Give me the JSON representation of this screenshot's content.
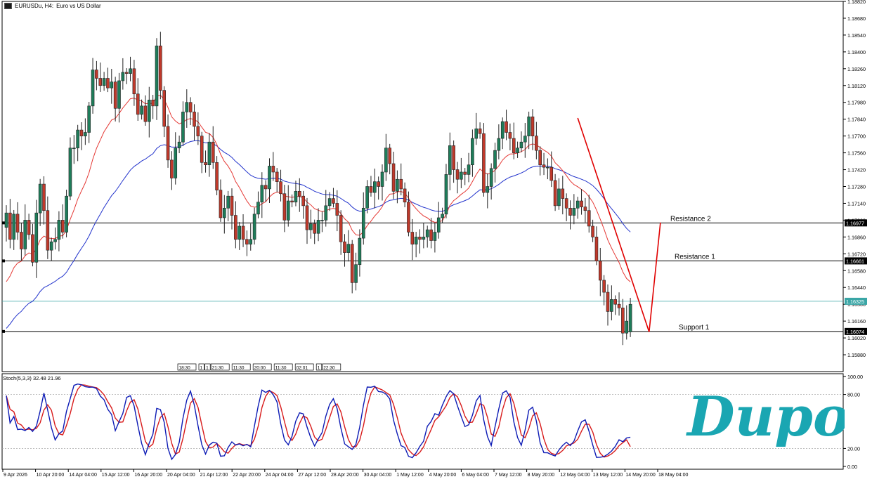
{
  "header": {
    "symbol": "EURUSDu, H4:",
    "description": "Euro vs US Dollar"
  },
  "colors": {
    "bull": "#1e7d5a",
    "bear": "#c0392b",
    "ma_fast": "#e53935",
    "ma_slow": "#2233cc",
    "stoch_k": "#0d1bb5",
    "stoch_d": "#d81b1b",
    "pattern": "#e00000",
    "bid_line": "#3aa6a6",
    "logo": "#1aa6b2"
  },
  "chart_data": [
    {
      "type": "candlestick",
      "symbol": "EURUSDu",
      "timeframe": "H4",
      "ylim": [
        1.1574,
        1.1882
      ],
      "y_ticks": [
        "1.18820",
        "1.18680",
        "1.18540",
        "1.18400",
        "1.18260",
        "1.18120",
        "1.17980",
        "1.17840",
        "1.17700",
        "1.17560",
        "1.17420",
        "1.17280",
        "1.17140",
        "1.17000",
        "1.16860",
        "1.16720",
        "1.16580",
        "1.16440",
        "1.16300",
        "1.16160",
        "1.16020",
        "1.15880"
      ],
      "x_ticks": [
        "9 Apr 2026",
        "10 Apr 20:00",
        "14 Apr 04:00",
        "15 Apr 12:00",
        "16 Apr 20:00",
        "20 Apr 04:00",
        "21 Apr 12:00",
        "22 Apr 20:00",
        "24 Apr 04:00",
        "27 Apr 12:00",
        "28 Apr 20:00",
        "30 Apr 04:00",
        "1 May 12:00",
        "4 May 20:00",
        "6 May 04:00",
        "7 May 12:00",
        "8 May 20:00",
        "12 May 04:00",
        "13 May 12:00",
        "14 May 20:00",
        "18 May 04:00"
      ],
      "closes": [
        1.1706,
        1.1684,
        1.1705,
        1.169,
        1.1676,
        1.17,
        1.1688,
        1.1665,
        1.1706,
        1.173,
        1.1708,
        1.1675,
        1.1682,
        1.1684,
        1.17,
        1.169,
        1.172,
        1.176,
        1.176,
        1.1775,
        1.177,
        1.1773,
        1.1795,
        1.1825,
        1.1818,
        1.1812,
        1.1818,
        1.181,
        1.1815,
        1.1793,
        1.1816,
        1.1823,
        1.1822,
        1.1826,
        1.1805,
        1.1788,
        1.1795,
        1.1782,
        1.18,
        1.1795,
        1.1845,
        1.1808,
        1.1778,
        1.175,
        1.1735,
        1.176,
        1.1765,
        1.179,
        1.1798,
        1.179,
        1.1778,
        1.177,
        1.1748,
        1.1746,
        1.1765,
        1.1748,
        1.1725,
        1.1702,
        1.171,
        1.172,
        1.1704,
        1.1684,
        1.1695,
        1.1684,
        1.168,
        1.1684,
        1.1705,
        1.1715,
        1.1729,
        1.1726,
        1.1745,
        1.174,
        1.1732,
        1.1722,
        1.17,
        1.1716,
        1.1715,
        1.1724,
        1.172,
        1.1712,
        1.1692,
        1.1697,
        1.1689,
        1.17,
        1.17,
        1.1712,
        1.1718,
        1.1714,
        1.1704,
        1.1682,
        1.1673,
        1.168,
        1.1648,
        1.1663,
        1.1685,
        1.171,
        1.1728,
        1.1723,
        1.1732,
        1.1728,
        1.174,
        1.176,
        1.1747,
        1.1724,
        1.1734,
        1.1726,
        1.1715,
        1.169,
        1.168,
        1.1686,
        1.1684,
        1.1686,
        1.1692,
        1.1683,
        1.169,
        1.1702,
        1.1705,
        1.1738,
        1.1762,
        1.1742,
        1.1734,
        1.174,
        1.1738,
        1.1746,
        1.1768,
        1.1776,
        1.1772,
        1.1723,
        1.1728,
        1.1743,
        1.1758,
        1.1768,
        1.1782,
        1.1773,
        1.1768,
        1.1756,
        1.176,
        1.1765,
        1.177,
        1.1786,
        1.177,
        1.1758,
        1.1746,
        1.1744,
        1.1744,
        1.1733,
        1.1712,
        1.1726,
        1.1718,
        1.171,
        1.1704,
        1.171,
        1.1716,
        1.1711,
        1.1708,
        1.1695,
        1.1686,
        1.1666,
        1.165,
        1.164,
        1.1624,
        1.1634,
        1.163,
        1.1627,
        1.1606,
        1.1616,
        1.163
      ],
      "open_last": 1.1607,
      "moving_averages": [
        {
          "period": "fast",
          "color_key": "ma_fast"
        },
        {
          "period": "slow",
          "color_key": "ma_slow"
        }
      ],
      "horizontal_levels": [
        {
          "label": "Resistance 2",
          "price": 1.16977,
          "tag": "1.16977"
        },
        {
          "label": "Resistance 1",
          "price": 1.16661,
          "tag": "1.16661"
        },
        {
          "label": "Support 1",
          "price": 1.16074,
          "tag": "1.16074"
        }
      ],
      "bid_price": {
        "price": 1.16325,
        "tag": "1.16325"
      },
      "pattern_points": [
        {
          "bar": 152,
          "price": 1.1785
        },
        {
          "bar": 171,
          "price": 1.1607
        },
        {
          "bar": 174,
          "price": 1.1698
        }
      ],
      "session_tags": [
        "18:30",
        "1",
        "1",
        "21:30",
        "11:30",
        "20:00",
        "11:30",
        "02:01",
        "1",
        "22:30"
      ]
    },
    {
      "type": "line",
      "indicator": "Stochastic",
      "label": "Stoch(5,3,3) 32.48 21.96",
      "ylim": [
        0,
        100
      ],
      "y_ticks": [
        "100.00",
        "80.00",
        "20.00",
        "0.00"
      ],
      "levels": [
        80,
        20
      ],
      "k_last": 32.48,
      "d_last": 21.96
    }
  ],
  "logo": {
    "text": "Dupoin"
  }
}
